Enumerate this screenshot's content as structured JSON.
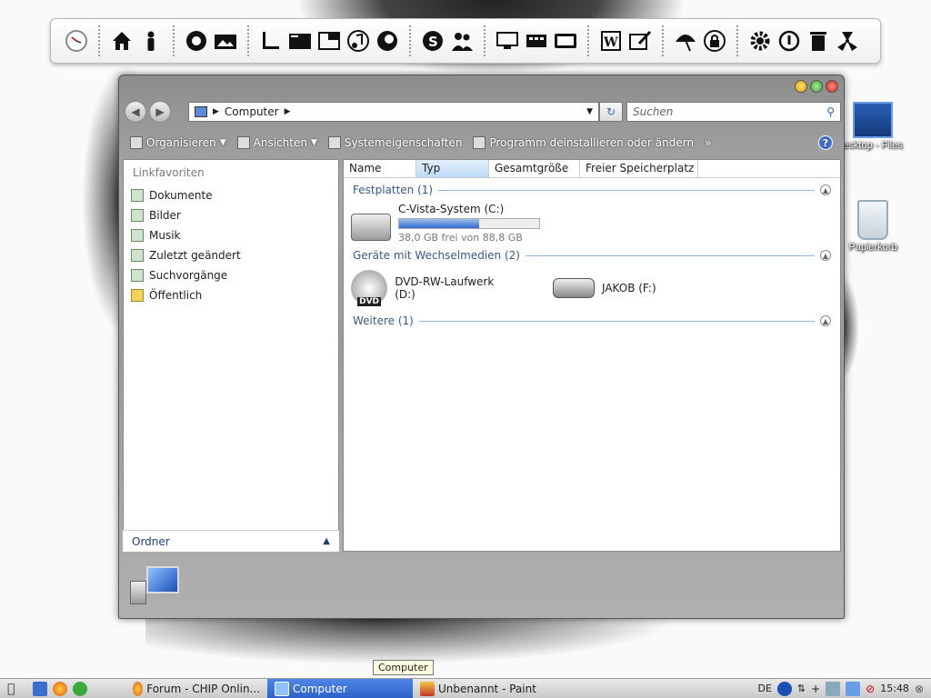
{
  "dock": {
    "icons": [
      "clock-icon",
      "home-icon",
      "user-icon",
      "aperture-icon",
      "photo-icon",
      "ruler-icon",
      "terminal-icon",
      "network-icon",
      "music-icon",
      "firefox-icon",
      "skype-icon",
      "contacts-icon",
      "monitor-icon",
      "devices-icon",
      "tv-icon",
      "word-icon",
      "writer-icon",
      "umbrella-icon",
      "lock-icon",
      "settings-icon",
      "power-icon",
      "trash-icon",
      "radiation-icon"
    ]
  },
  "desktop": {
    "icons": [
      {
        "label": "esktop - Files",
        "icon": "film-icon"
      },
      {
        "label": "Papierkorb",
        "icon": "recycle-bin-icon"
      }
    ]
  },
  "window": {
    "address": {
      "path": "Computer"
    },
    "search": {
      "placeholder": "Suchen"
    },
    "toolbar": {
      "organize": "Organisieren",
      "views": "Ansichten",
      "system_properties": "Systemeigenschaften",
      "uninstall": "Programm deinstallieren oder ändern",
      "more": "»",
      "help": "?"
    },
    "nav": {
      "header": "Linkfavoriten",
      "items": [
        {
          "label": "Dokumente"
        },
        {
          "label": "Bilder"
        },
        {
          "label": "Musik"
        },
        {
          "label": "Zuletzt geändert"
        },
        {
          "label": "Suchvorgänge"
        },
        {
          "label": "Öffentlich"
        }
      ],
      "folder_label": "Ordner"
    },
    "columns": [
      "Name",
      "Typ",
      "Gesamtgröße",
      "Freier Speicherplatz"
    ],
    "groups": {
      "hard_disks": {
        "title": "Festplatten (1)",
        "drive": {
          "name": "C-Vista-System (C:)",
          "free_text": "38,0 GB frei von 88,8 GB",
          "used_fraction": 0.57
        }
      },
      "removable": {
        "title": "Geräte mit Wechselmedien (2)",
        "drives": [
          {
            "name": "DVD-RW-Laufwerk (D:)",
            "badge": "DVD"
          },
          {
            "name": "JAKOB (F:)"
          }
        ]
      },
      "other": {
        "title": "Weitere (1)"
      }
    }
  },
  "tooltip": "Computer",
  "taskbar": {
    "tasks": [
      {
        "label": "Forum - CHIP Onlin..."
      },
      {
        "label": "Computer"
      },
      {
        "label": "Unbenannt - Paint"
      }
    ],
    "language": "DE",
    "clock": "15:48"
  },
  "colors": {
    "accent": "#2d5fc8",
    "progress": "#2f6bd1",
    "group_text": "#3a5a88"
  }
}
